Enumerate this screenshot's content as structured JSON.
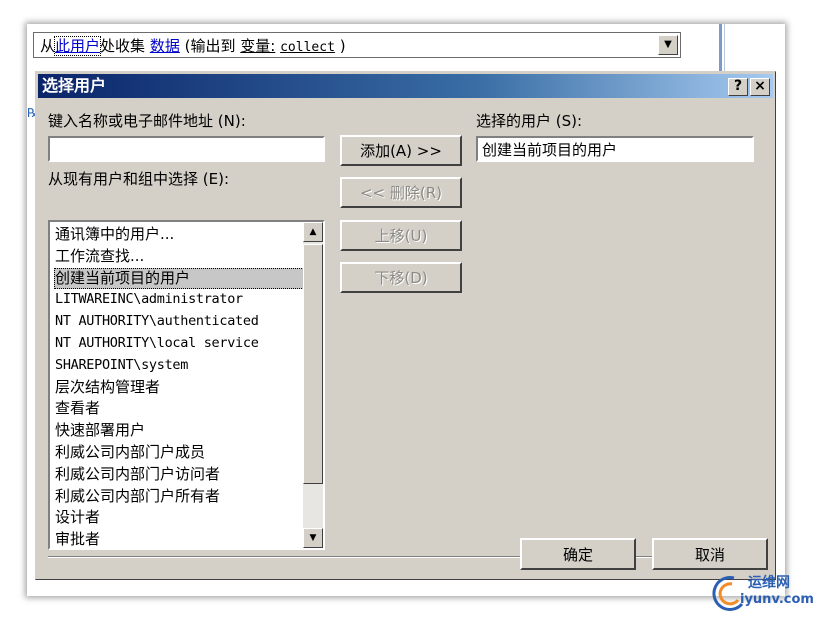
{
  "sentence": {
    "prefix": "从",
    "user_link": "此用户",
    "middle": "处收集",
    "data_link": "数据",
    "paren_open": "(输出到",
    "variable_label": "变量:",
    "variable_name": "collect",
    "paren_close": ")"
  },
  "dialog": {
    "title": "选择用户",
    "help_button": "?",
    "close_button": "×",
    "name_email_label": "键入名称或电子邮件地址",
    "name_email_hotkey": "(N):",
    "name_email_value": "",
    "existing_label": "从现有用户和组中选择",
    "existing_hotkey": "(E):",
    "existing_items": [
      {
        "text": "通讯簿中的用户...",
        "mono": false
      },
      {
        "text": "工作流查找...",
        "mono": false
      },
      {
        "text": "创建当前项目的用户",
        "mono": false
      },
      {
        "text": "LITWAREINC\\administrator",
        "mono": true
      },
      {
        "text": "NT AUTHORITY\\authenticated",
        "mono": true
      },
      {
        "text": "NT AUTHORITY\\local service",
        "mono": true
      },
      {
        "text": "SHAREPOINT\\system",
        "mono": true
      },
      {
        "text": "层次结构管理者",
        "mono": false
      },
      {
        "text": "查看者",
        "mono": false
      },
      {
        "text": "快速部署用户",
        "mono": false
      },
      {
        "text": "利威公司内部门户成员",
        "mono": false
      },
      {
        "text": "利威公司内部门户访问者",
        "mono": false
      },
      {
        "text": "利威公司内部门户所有者",
        "mono": false
      },
      {
        "text": "设计者",
        "mono": false
      },
      {
        "text": "审批者",
        "mono": false
      }
    ],
    "selected_index": 2,
    "add_button": "添加(A) >>",
    "remove_button": "<< 删除(R)",
    "up_button": "上移(U)",
    "down_button": "下移(D)",
    "selected_users_label": "选择的用户",
    "selected_users_hotkey": "(S):",
    "selected_users_value": "创建当前项目的用户",
    "ok_button": "确定",
    "cancel_button": "取消"
  },
  "watermark": {
    "cn": "运维网",
    "en": "iyunv.com"
  }
}
